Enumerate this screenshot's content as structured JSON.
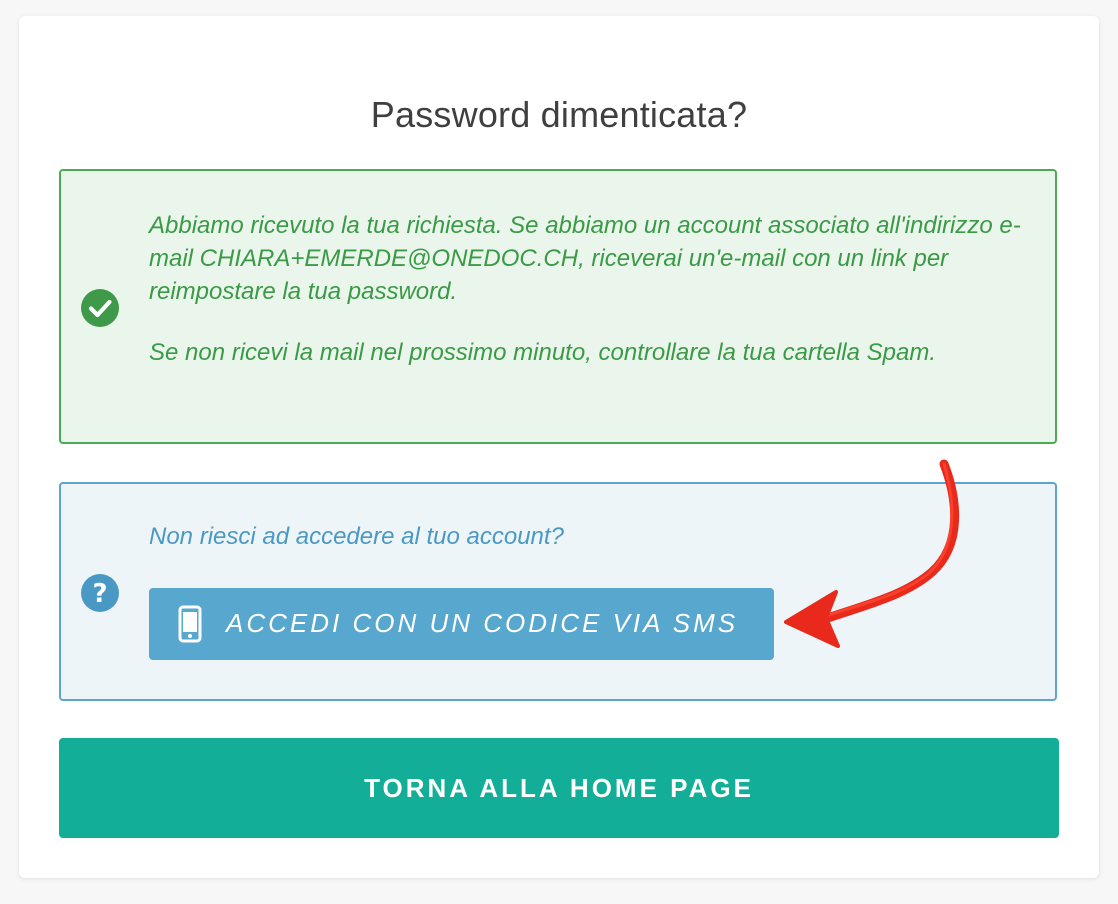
{
  "page": {
    "title": "Password dimenticata?"
  },
  "success_alert": {
    "paragraph_1": "Abbiamo ricevuto la tua richiesta. Se abbiamo un account associato all'indirizzo e-mail CHIARA+EMERDE@ONEDOC.CH, riceverai un'e-mail con un link per reimpostare la tua password.",
    "paragraph_2": "Se non ricevi la mail nel prossimo minuto, controllare la tua cartella Spam.",
    "icon": "check-circle-icon",
    "color": "#3a9a45"
  },
  "info_alert": {
    "question": "Non riesci ad accedere al tuo account?",
    "icon": "question-circle-icon",
    "color": "#4a98c4",
    "sms_button_label": "ACCEDI CON UN CODICE VIA SMS",
    "sms_button_icon": "mobile-phone-icon"
  },
  "home_button": {
    "label": "TORNA ALLA HOME PAGE",
    "color": "#12ae98"
  },
  "annotation": {
    "type": "hand-drawn-arrow",
    "color": "#e8291c"
  }
}
